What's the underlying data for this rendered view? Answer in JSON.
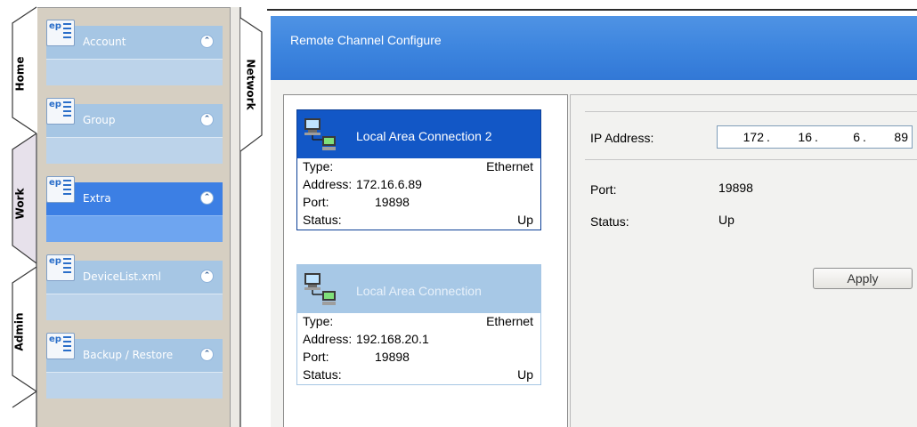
{
  "tabs": [
    {
      "label": "Home",
      "active": true
    },
    {
      "label": "Work",
      "active": false
    },
    {
      "label": "Admin",
      "active": false
    }
  ],
  "nav": {
    "groups": [
      {
        "label": "Account",
        "active": false
      },
      {
        "label": "Group",
        "active": false
      },
      {
        "label": "Extra",
        "active": true
      },
      {
        "label": "DeviceList.xml",
        "active": false
      },
      {
        "label": "Backup / Restore",
        "active": false
      }
    ],
    "collapse_glyph": "⌃⌃",
    "icon_badge": "ep"
  },
  "section_tab": {
    "label": "Network"
  },
  "banner": {
    "title": "Remote Channel Configure"
  },
  "connections": [
    {
      "name": "Local Area Connection 2",
      "selected": true,
      "type_label": "Type:",
      "type_value": "Ethernet",
      "address_label": "Address:",
      "address_value": "172.16.6.89",
      "port_label": "Port:",
      "port_value": "19898",
      "status_label": "Status:",
      "status_value": "Up"
    },
    {
      "name": "Local Area Connection",
      "selected": false,
      "type_label": "Type:",
      "type_value": "Ethernet",
      "address_label": "Address:",
      "address_value": "192.168.20.1",
      "port_label": "Port:",
      "port_value": "19898",
      "status_label": "Status:",
      "status_value": "Up"
    }
  ],
  "detail": {
    "ip_label": "IP Address:",
    "ip_octets": [
      "172",
      "16",
      "6",
      "89"
    ],
    "ip_separator": ".",
    "port_label": "Port:",
    "port_value": "19898",
    "status_label": "Status:",
    "status_value": "Up",
    "apply_label": "Apply"
  },
  "colors": {
    "banner": "#3c84de",
    "selected_connection": "#1257c6",
    "inactive_connection": "#a7c8e6",
    "nav_active": "#3c7fe4",
    "nav_inactive": "#a6c6e4",
    "nav_background": "#d6cfc2"
  }
}
